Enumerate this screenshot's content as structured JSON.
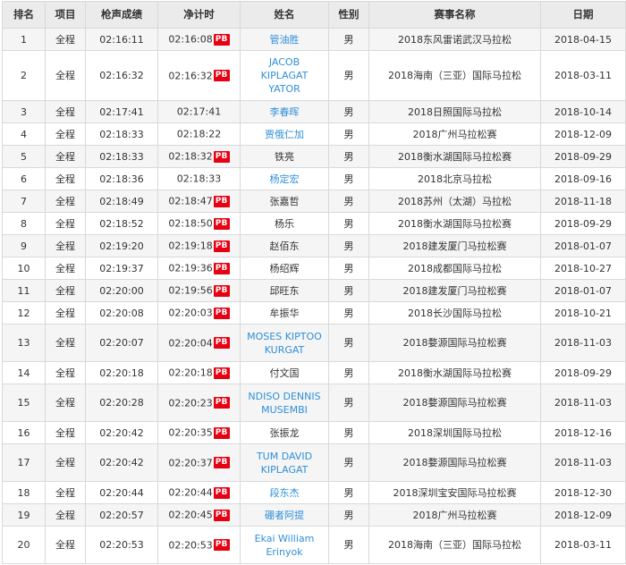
{
  "headers": {
    "rank": "排名",
    "event": "项目",
    "gun_time": "枪声成绩",
    "net_time": "净计时",
    "name": "姓名",
    "gender": "性别",
    "race": "赛事名称",
    "date": "日期"
  },
  "rows": [
    {
      "rank": "1",
      "event": "全程",
      "gun_time": "02:16:11",
      "net_time": "02:16:08",
      "pb": "PB",
      "name": "管油胜",
      "link": true,
      "gender": "男",
      "race": "2018东风雷诺武汉马拉松",
      "date": "2018-04-15",
      "h": "h1"
    },
    {
      "rank": "2",
      "event": "全程",
      "gun_time": "02:16:32",
      "net_time": "02:16:32",
      "pb": "PB",
      "name": "JACOB KIPLAGAT YATOR",
      "link": true,
      "gender": "男",
      "race": "2018海南（三亚）国际马拉松",
      "date": "2018-03-11",
      "h": "h3"
    },
    {
      "rank": "3",
      "event": "全程",
      "gun_time": "02:17:41",
      "net_time": "02:17:41",
      "pb": "",
      "name": "李春晖",
      "link": true,
      "gender": "男",
      "race": "2018日照国际马拉松",
      "date": "2018-10-14",
      "h": "h1"
    },
    {
      "rank": "4",
      "event": "全程",
      "gun_time": "02:18:33",
      "net_time": "02:18:22",
      "pb": "",
      "name": "贾俄仁加",
      "link": true,
      "gender": "男",
      "race": "2018广州马拉松赛",
      "date": "2018-12-09",
      "h": "h1"
    },
    {
      "rank": "5",
      "event": "全程",
      "gun_time": "02:18:33",
      "net_time": "02:18:32",
      "pb": "PB",
      "name": "铁亮",
      "link": false,
      "gender": "男",
      "race": "2018衡水湖国际马拉松赛",
      "date": "2018-09-29",
      "h": "h1"
    },
    {
      "rank": "6",
      "event": "全程",
      "gun_time": "02:18:36",
      "net_time": "02:18:33",
      "pb": "",
      "name": "杨定宏",
      "link": true,
      "gender": "男",
      "race": "2018北京马拉松",
      "date": "2018-09-16",
      "h": "h1"
    },
    {
      "rank": "7",
      "event": "全程",
      "gun_time": "02:18:49",
      "net_time": "02:18:47",
      "pb": "PB",
      "name": "张嘉哲",
      "link": false,
      "gender": "男",
      "race": "2018苏州（太湖）马拉松",
      "date": "2018-11-18",
      "h": "h1"
    },
    {
      "rank": "8",
      "event": "全程",
      "gun_time": "02:18:52",
      "net_time": "02:18:50",
      "pb": "PB",
      "name": "杨乐",
      "link": false,
      "gender": "男",
      "race": "2018衡水湖国际马拉松赛",
      "date": "2018-09-29",
      "h": "h1"
    },
    {
      "rank": "9",
      "event": "全程",
      "gun_time": "02:19:20",
      "net_time": "02:19:18",
      "pb": "PB",
      "name": "赵佰东",
      "link": false,
      "gender": "男",
      "race": "2018建发厦门马拉松赛",
      "date": "2018-01-07",
      "h": "h1"
    },
    {
      "rank": "10",
      "event": "全程",
      "gun_time": "02:19:37",
      "net_time": "02:19:36",
      "pb": "PB",
      "name": "杨绍辉",
      "link": false,
      "gender": "男",
      "race": "2018成都国际马拉松",
      "date": "2018-10-27",
      "h": "h1"
    },
    {
      "rank": "11",
      "event": "全程",
      "gun_time": "02:20:00",
      "net_time": "02:19:56",
      "pb": "PB",
      "name": "邱旺东",
      "link": false,
      "gender": "男",
      "race": "2018建发厦门马拉松赛",
      "date": "2018-01-07",
      "h": "h1"
    },
    {
      "rank": "12",
      "event": "全程",
      "gun_time": "02:20:08",
      "net_time": "02:20:03",
      "pb": "PB",
      "name": "牟振华",
      "link": false,
      "gender": "男",
      "race": "2018长沙国际马拉松",
      "date": "2018-10-21",
      "h": "h1"
    },
    {
      "rank": "13",
      "event": "全程",
      "gun_time": "02:20:07",
      "net_time": "02:20:04",
      "pb": "PB",
      "name": "MOSES KIPTOO KURGAT",
      "link": true,
      "gender": "男",
      "race": "2018婺源国际马拉松赛",
      "date": "2018-11-03",
      "h": "h2"
    },
    {
      "rank": "14",
      "event": "全程",
      "gun_time": "02:20:18",
      "net_time": "02:20:18",
      "pb": "PB",
      "name": "付文国",
      "link": false,
      "gender": "男",
      "race": "2018衡水湖国际马拉松赛",
      "date": "2018-09-29",
      "h": "h1"
    },
    {
      "rank": "15",
      "event": "全程",
      "gun_time": "02:20:28",
      "net_time": "02:20:23",
      "pb": "PB",
      "name": "NDISO DENNIS MUSEMBI",
      "link": true,
      "gender": "男",
      "race": "2018婺源国际马拉松赛",
      "date": "2018-11-03",
      "h": "h2"
    },
    {
      "rank": "16",
      "event": "全程",
      "gun_time": "02:20:42",
      "net_time": "02:20:35",
      "pb": "PB",
      "name": "张振龙",
      "link": false,
      "gender": "男",
      "race": "2018深圳国际马拉松",
      "date": "2018-12-16",
      "h": "h1"
    },
    {
      "rank": "17",
      "event": "全程",
      "gun_time": "02:20:42",
      "net_time": "02:20:37",
      "pb": "PB",
      "name": "TUM DAVID KIPLAGAT",
      "link": true,
      "gender": "男",
      "race": "2018婺源国际马拉松赛",
      "date": "2018-11-03",
      "h": "h2"
    },
    {
      "rank": "18",
      "event": "全程",
      "gun_time": "02:20:44",
      "net_time": "02:20:44",
      "pb": "PB",
      "name": "段东杰",
      "link": true,
      "gender": "男",
      "race": "2018深圳宝安国际马拉松赛",
      "date": "2018-12-30",
      "h": "h1"
    },
    {
      "rank": "19",
      "event": "全程",
      "gun_time": "02:20:57",
      "net_time": "02:20:45",
      "pb": "PB",
      "name": "硼者阿提",
      "link": true,
      "gender": "男",
      "race": "2018广州马拉松赛",
      "date": "2018-12-09",
      "h": "h1"
    },
    {
      "rank": "20",
      "event": "全程",
      "gun_time": "02:20:53",
      "net_time": "02:20:53",
      "pb": "PB",
      "name": "Ekai William Erinyok",
      "link": true,
      "gender": "男",
      "race": "2018海南（三亚）国际马拉松",
      "date": "2018-03-11",
      "h": "h2"
    }
  ],
  "colors": {
    "header_bg": "#ebebeb",
    "row_alt_bg": "#f5f5f5",
    "border": "#d9d9d9",
    "link": "#2f8fd8",
    "pb_badge": "#e60012"
  }
}
